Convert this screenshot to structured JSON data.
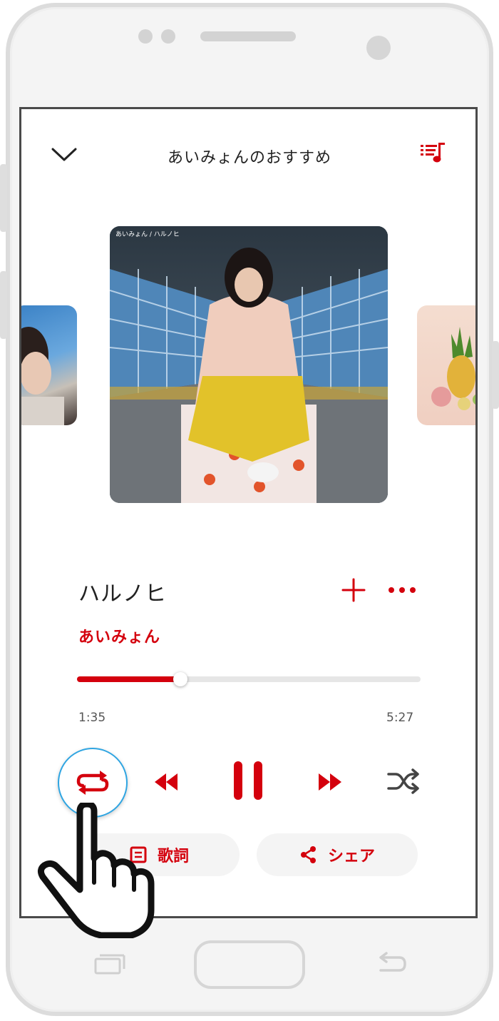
{
  "header": {
    "title": "あいみょんのおすすめ"
  },
  "album": {
    "caption": "あいみょん / ハルノヒ"
  },
  "track": {
    "title": "ハルノヒ",
    "artist": "あいみょん"
  },
  "progress": {
    "elapsed": "1:35",
    "total": "5:27",
    "fraction": 0.3
  },
  "actions": {
    "lyrics_label": "歌詞",
    "share_label": "シェア"
  },
  "colors": {
    "accent": "#d4000d",
    "highlight_ring": "#2fa5e2"
  },
  "icons": {
    "collapse": "chevron-down-icon",
    "queue": "playlist-icon",
    "add": "plus-icon",
    "more": "more-icon",
    "repeat": "repeat-icon",
    "previous": "previous-icon",
    "pause": "pause-icon",
    "next": "next-icon",
    "shuffle": "shuffle-icon",
    "lyrics": "lyrics-icon",
    "share": "share-icon"
  }
}
